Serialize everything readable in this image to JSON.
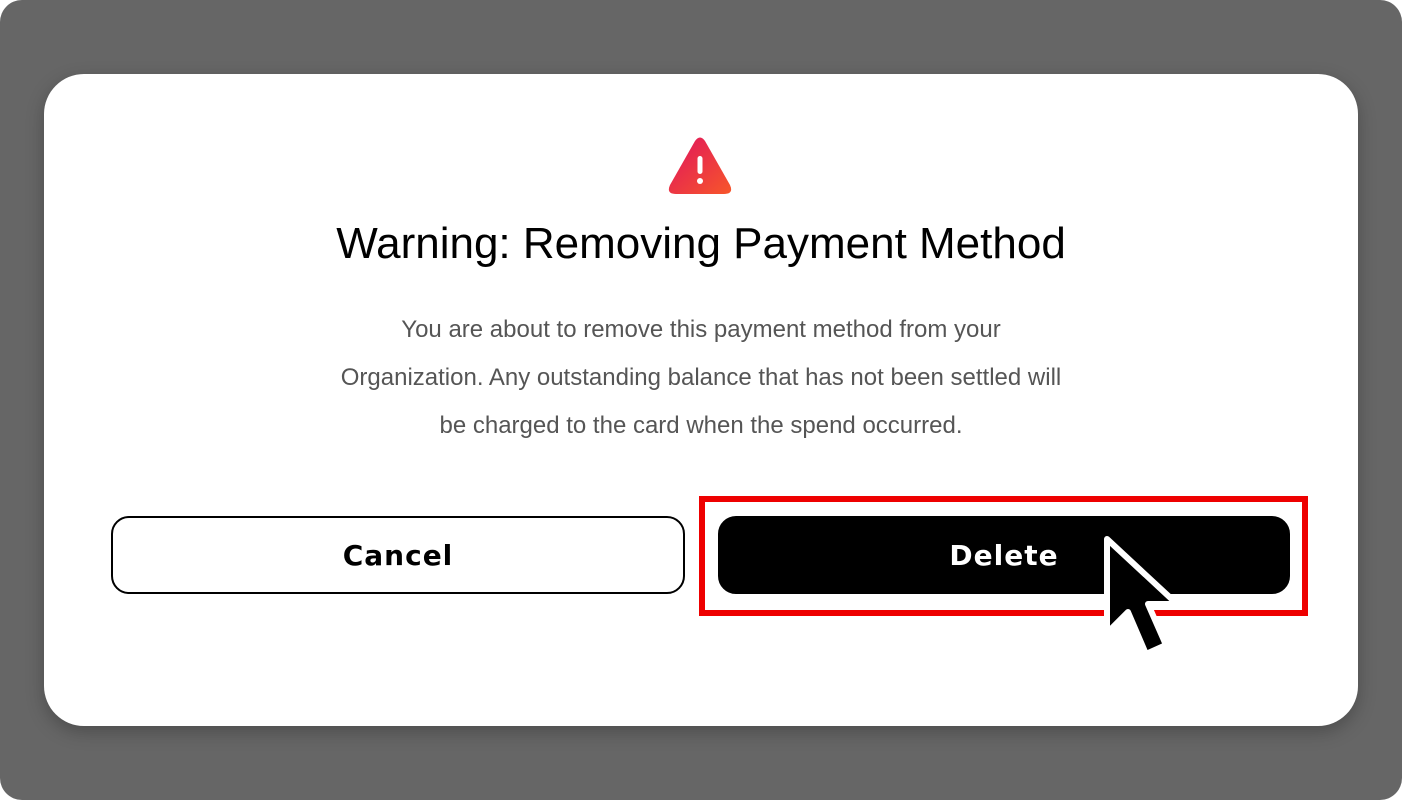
{
  "dialog": {
    "icon": "warning-triangle-icon",
    "title": "Warning: Removing Payment Method",
    "body_lines": [
      "You are about to remove this payment method from your",
      "Organization. Any outstanding balance that has not been settled will",
      "be charged to the card when the spend occurred."
    ]
  },
  "buttons": {
    "cancel_label": "Cancel",
    "delete_label": "Delete"
  },
  "overlay": {
    "highlight_color": "#ee0000",
    "cursor": "arrow-cursor-icon"
  },
  "colors": {
    "backdrop": "#666666",
    "warning_gradient": [
      "#e8185a",
      "#f5522a"
    ]
  }
}
